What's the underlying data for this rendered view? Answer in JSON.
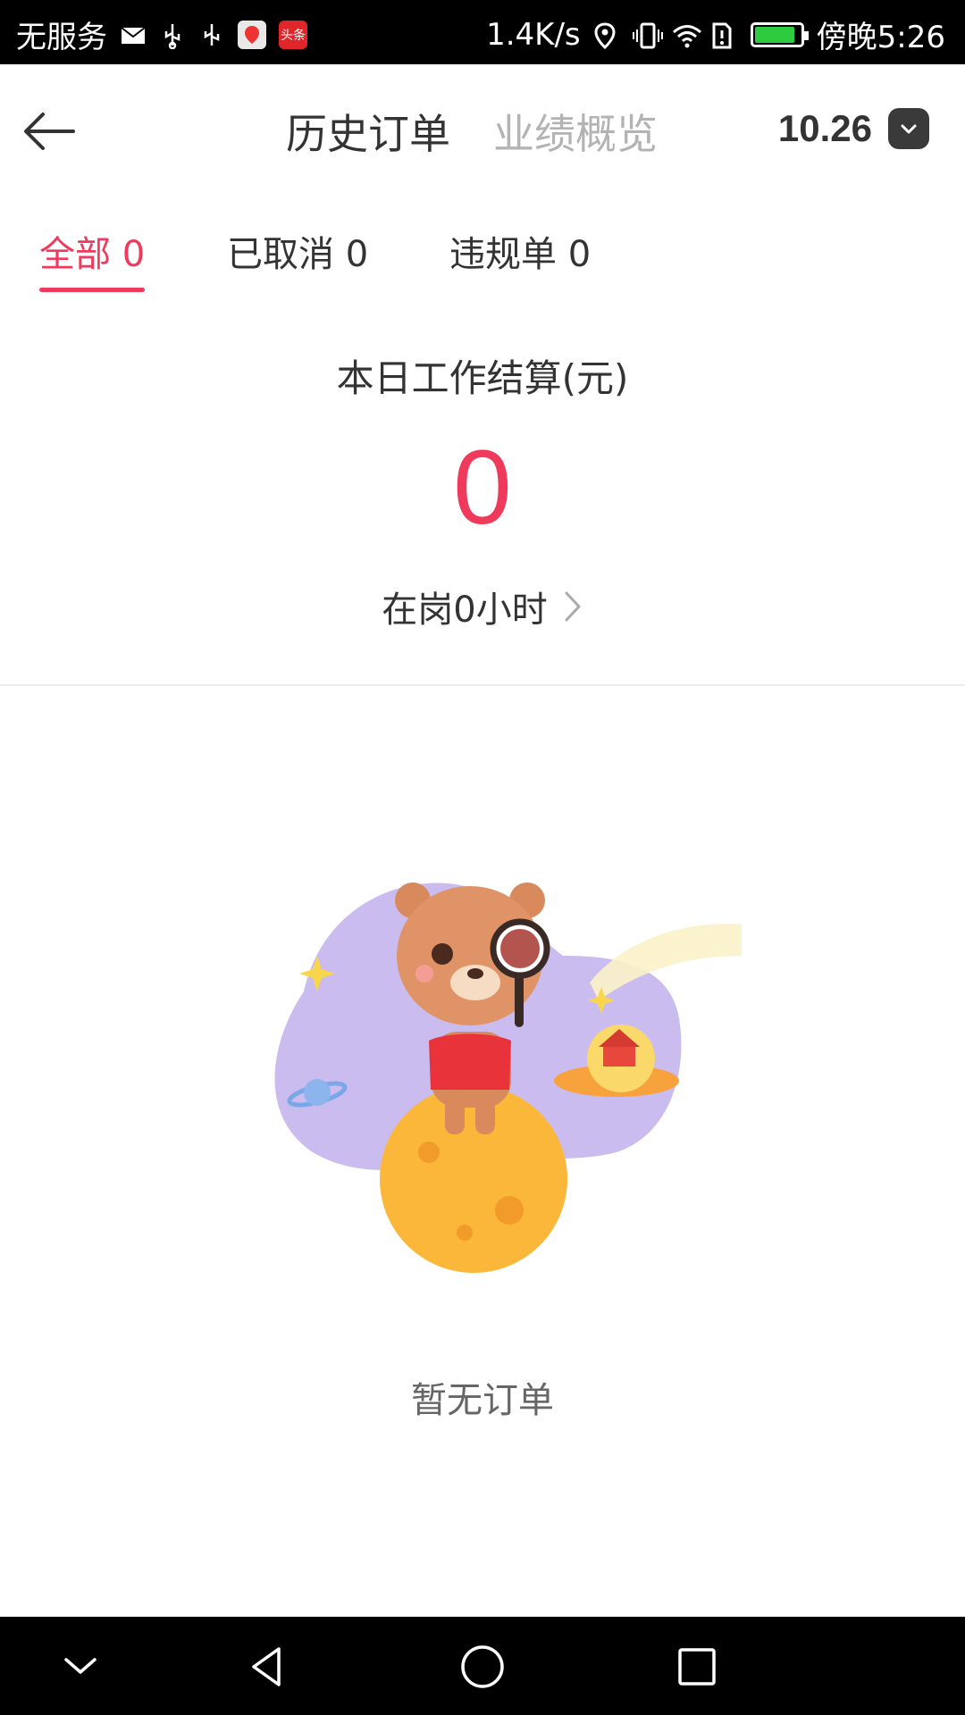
{
  "status_bar": {
    "carrier": "无服务",
    "speed": "1.4K/s",
    "time": "傍晚5:26",
    "app_badge": "头条"
  },
  "header": {
    "tabs": [
      "历史订单",
      "业绩概览"
    ],
    "date": "10.26"
  },
  "filter_tabs": [
    {
      "label": "全部 0"
    },
    {
      "label": "已取消 0"
    },
    {
      "label": "违规单 0"
    }
  ],
  "summary": {
    "label": "本日工作结算(元)",
    "value": "0",
    "on_duty": "在岗0小时"
  },
  "empty_state": {
    "text": "暂无订单"
  },
  "colors": {
    "accent": "#f03a5c",
    "text": "#333333",
    "muted": "#b3b3b3"
  }
}
